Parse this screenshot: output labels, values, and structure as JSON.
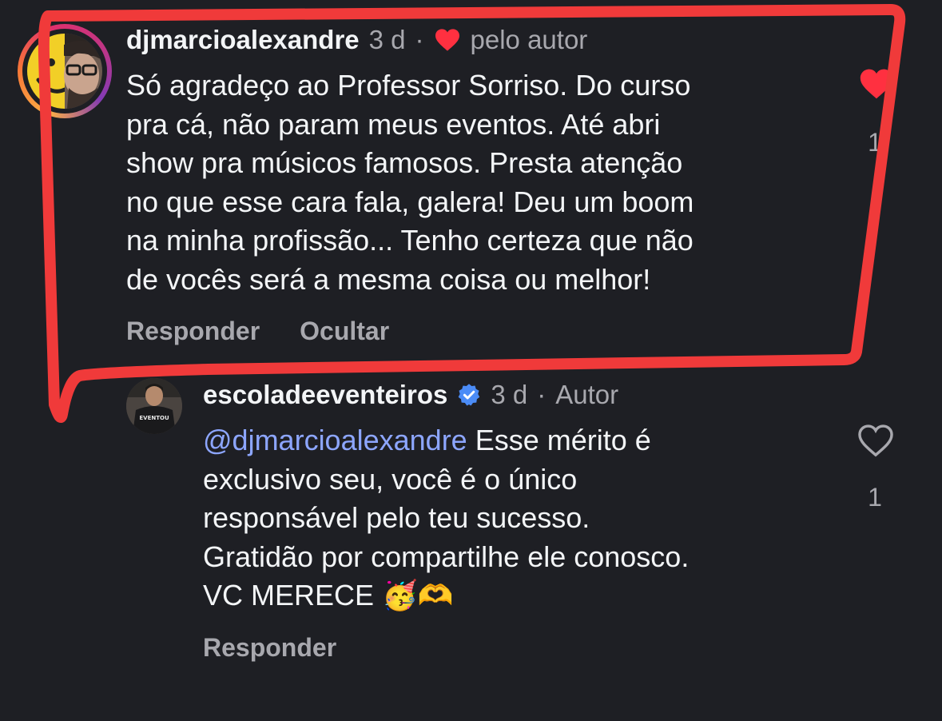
{
  "comments": [
    {
      "username": "djmarcioalexandre",
      "time": "3 d",
      "separator": "·",
      "liked_by_author_label": "pelo autor",
      "text": "Só agradeço ao Professor Sorriso. Do curso pra cá, não param meus eventos. Até abri show pra músicos famosos. Presta atenção no que esse cara fala, galera! Deu um boom na minha profissão... Tenho certeza que não de vocês será a mesma coisa ou melhor!",
      "lines": [
        "Só agradeço ao Professor Sorriso. Do curso",
        "pra cá, não param meus eventos. Até abri",
        "show pra músicos famosos. Presta atenção",
        "no que esse cara fala, galera! Deu um boom",
        "na minha profissão... Tenho certeza que não",
        "de vocês será a mesma coisa ou melhor!"
      ],
      "actions": {
        "reply": "Responder",
        "hide": "Ocultar"
      },
      "like_count": "1",
      "liked": true,
      "avatar_icon": "smiley-half-face-avatar"
    },
    {
      "username": "escoladeeventeiros",
      "verified": true,
      "time": "3 d",
      "separator": "·",
      "author_label": "Autor",
      "mention": "@djmarcioalexandre",
      "lines": [
        " Esse mérito é",
        "exclusivo seu, você é o único",
        "responsável pelo teu sucesso.",
        "Gratidão por compartilhe ele conosco.",
        "VC MERECE 🥳🫶"
      ],
      "actions": {
        "reply": "Responder"
      },
      "like_count": "1",
      "liked": false,
      "avatar_icon": "man-in-eventou-shirt-avatar"
    }
  ],
  "colors": {
    "background": "#1e1f24",
    "text": "#f3f5f7",
    "secondary": "#a8a8ae",
    "like_red": "#ff3040",
    "verified_blue": "#4b8cf7",
    "mention": "#8da6ff",
    "annotation_red": "#f03a3a"
  }
}
